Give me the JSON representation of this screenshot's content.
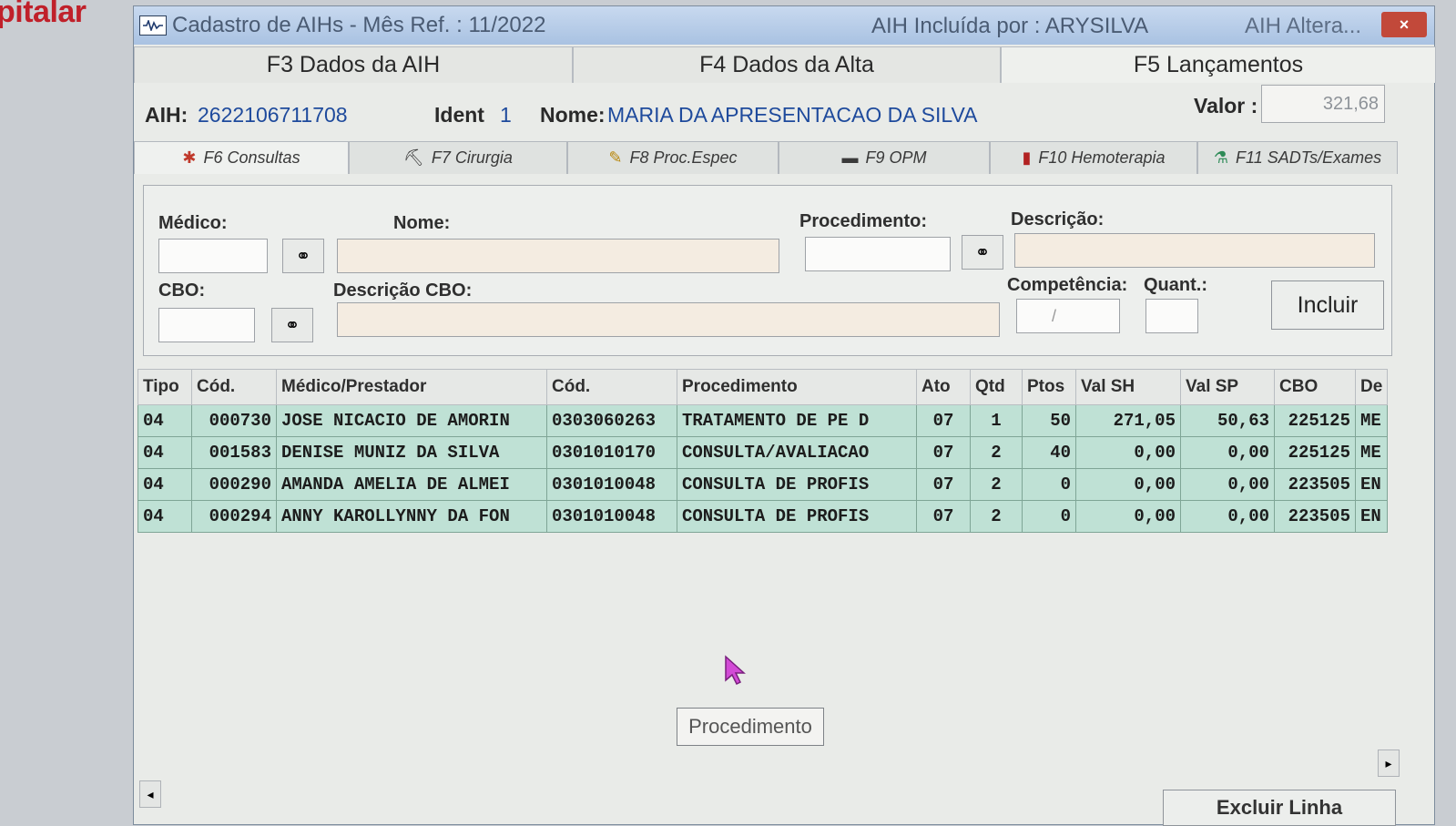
{
  "background": {
    "logo_text": "pitalar"
  },
  "window": {
    "title": "Cadastro de AIHs  -  Mês Ref. : 11/2022",
    "included_by": "AIH Incluída por : ARYSILVA",
    "altered": "AIH Altera...",
    "close": "×"
  },
  "main_tabs": [
    "F3 Dados da AIH",
    "F4 Dados da Alta",
    "F5 Lançamentos"
  ],
  "header": {
    "aih_label": "AIH:",
    "aih_value": "2622106711708",
    "ident_label": "Ident",
    "ident_value": "1",
    "nome_label": "Nome:",
    "nome_value": "MARIA DA  APRESENTACAO DA SILVA",
    "valor_label": "Valor :",
    "valor_value": "321,68"
  },
  "sub_tabs": [
    {
      "label": "F6 Consultas",
      "icon": "doctor-icon"
    },
    {
      "label": "F7 Cirurgia",
      "icon": "surgery-icon"
    },
    {
      "label": "F8 Proc.Espec",
      "icon": "syringe-icon"
    },
    {
      "label": "F9 OPM",
      "icon": "opm-icon"
    },
    {
      "label": "F10 Hemoterapia",
      "icon": "blood-bag-icon"
    },
    {
      "label": "F11 SADTs/Exames",
      "icon": "flask-icon"
    }
  ],
  "form": {
    "medico_label": "Médico:",
    "nome_label": "Nome:",
    "procedimento_label": "Procedimento:",
    "descricao_label": "Descrição:",
    "cbo_label": "CBO:",
    "descricao_cbo_label": "Descrição CBO:",
    "competencia_label": "Competência:",
    "quant_label": "Quant.:",
    "competencia_value": "/",
    "incluir_label": "Incluir"
  },
  "table": {
    "columns": [
      "Tipo",
      "Cód.",
      "Médico/Prestador",
      "Cód.",
      "Procedimento",
      "Ato",
      "Qtd",
      "Ptos",
      "Val SH",
      "Val SP",
      "CBO",
      "De"
    ],
    "rows": [
      [
        "04",
        "000730",
        "JOSE NICACIO DE AMORIN",
        "0303060263",
        "TRATAMENTO DE PE D",
        "07",
        "1",
        "50",
        "271,05",
        "50,63",
        "225125",
        "ME"
      ],
      [
        "04",
        "001583",
        "DENISE MUNIZ DA SILVA",
        "0301010170",
        "CONSULTA/AVALIACAO",
        "07",
        "2",
        "40",
        "0,00",
        "0,00",
        "225125",
        "ME"
      ],
      [
        "04",
        "000290",
        "AMANDA AMELIA DE ALMEI",
        "0301010048",
        "CONSULTA DE PROFIS",
        "07",
        "2",
        "0",
        "0,00",
        "0,00",
        "223505",
        "EN"
      ],
      [
        "04",
        "000294",
        "ANNY KAROLLYNNY DA FON",
        "0301010048",
        "CONSULTA DE PROFIS",
        "07",
        "2",
        "0",
        "0,00",
        "0,00",
        "223505",
        "EN"
      ]
    ]
  },
  "tooltip": "Procedimento",
  "excluir_label": "Excluir Linha",
  "colors": {
    "grid_row": "#bfe1d5",
    "title_bar": "#b3cbe8",
    "close": "#c2493a",
    "name_blue": "#1e4a9c"
  }
}
